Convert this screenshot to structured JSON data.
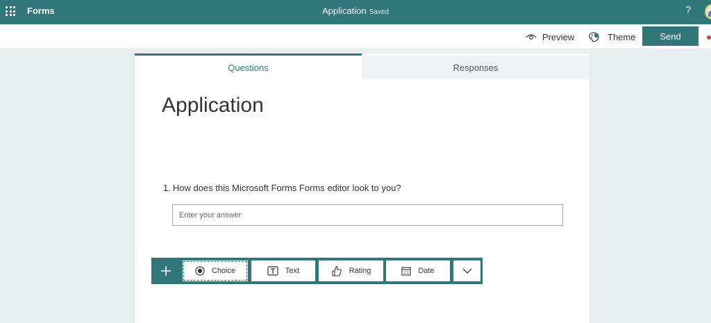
{
  "header": {
    "app_name": "Forms",
    "doc_title": "Application",
    "saved_status": "Saved",
    "help_label": "?",
    "icons": {
      "launcher": "waffle-icon",
      "help": "help-icon",
      "avatar": "avatar"
    }
  },
  "commands": {
    "preview_label": "Preview",
    "theme_label": "Theme",
    "send_label": "Send",
    "icons": {
      "preview": "eye-icon",
      "theme": "palette-icon"
    }
  },
  "tabs": [
    {
      "label": "Questions",
      "active": true
    },
    {
      "label": "Responses",
      "active": false
    }
  ],
  "form": {
    "title": "Application",
    "questions": [
      {
        "number": "1.",
        "text": "How does this Microsoft Forms Forms editor look to you?",
        "placeholder": "Enter your answer",
        "value": ""
      }
    ]
  },
  "toolbar": {
    "add_icon": "plus-icon",
    "buttons": [
      {
        "label": "Choice",
        "icon": "radio-icon"
      },
      {
        "label": "Text",
        "icon": "text-box-icon"
      },
      {
        "label": "Rating",
        "icon": "thumb-icon"
      },
      {
        "label": "Date",
        "icon": "calendar-icon"
      }
    ],
    "more_icon": "chevron-down-icon"
  },
  "colors": {
    "accent": "#31777a",
    "page_bg": "#e8eff1",
    "tab_inactive_bg": "#f0f3f4"
  }
}
